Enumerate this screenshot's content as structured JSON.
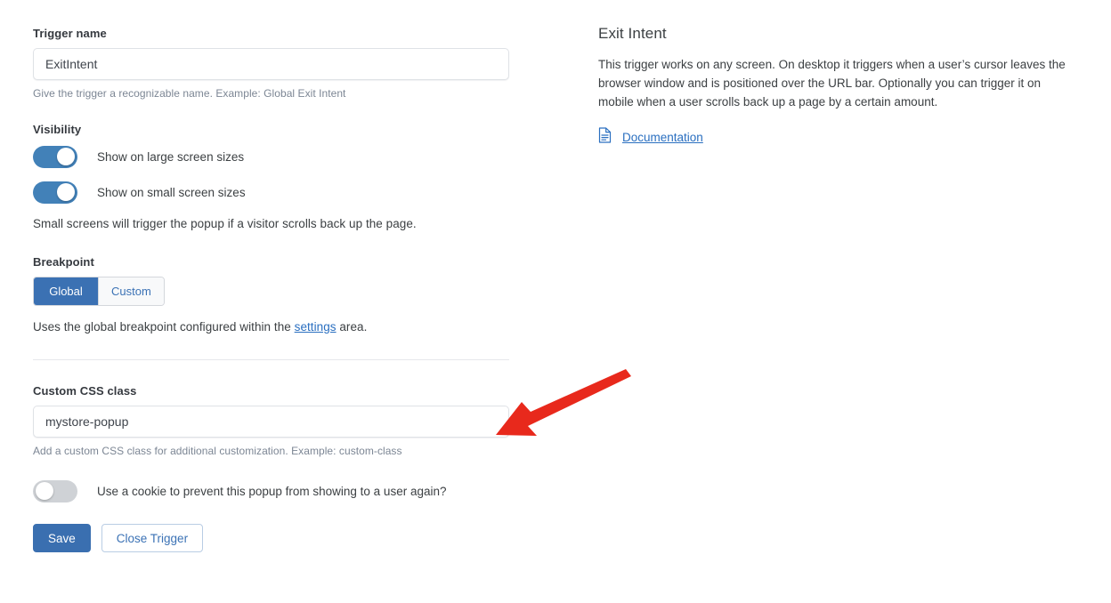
{
  "form": {
    "trigger_name": {
      "label": "Trigger name",
      "value": "ExitIntent",
      "placeholder": "",
      "helper": "Give the trigger a recognizable name. Example: Global Exit Intent"
    },
    "visibility": {
      "label": "Visibility",
      "toggles": [
        {
          "label": "Show on large screen sizes",
          "state": "on"
        },
        {
          "label": "Show on small screen sizes",
          "state": "on"
        }
      ],
      "note": "Small screens will trigger the popup if a visitor scrolls back up the page."
    },
    "breakpoint": {
      "label": "Breakpoint",
      "options": [
        {
          "label": "Global",
          "selected": true
        },
        {
          "label": "Custom",
          "selected": false
        }
      ],
      "note_before_link": "Uses the global breakpoint configured within the ",
      "note_link": "settings",
      "note_after_link": " area."
    },
    "custom_css": {
      "label": "Custom CSS class",
      "value": "mystore-popup",
      "placeholder": "",
      "helper": "Add a custom CSS class for additional customization. Example: custom-class"
    },
    "cookie": {
      "label": "Use a cookie to prevent this popup from showing to a user again?",
      "state": "off"
    },
    "actions": {
      "save_label": "Save",
      "close_label": "Close Trigger"
    }
  },
  "info_panel": {
    "title": "Exit Intent",
    "description": "This trigger works on any screen. On desktop it triggers when a user’s cursor leaves the browser window and is positioned over the URL bar. Optionally you can trigger it on mobile when a user scrolls back up a page by a certain amount.",
    "doc_icon": "document-icon",
    "doc_label": "Documentation"
  },
  "annotation": {
    "type": "arrow",
    "color": "#e8291c",
    "points_to": "custom-css-class-input"
  },
  "colors": {
    "accent_blue": "#3b71b3",
    "toggle_on": "#4281b8",
    "toggle_off": "#cfd2d6",
    "link_blue": "#2a6fc0",
    "helper_gray": "#7c8694",
    "arrow_red": "#e8291c"
  }
}
